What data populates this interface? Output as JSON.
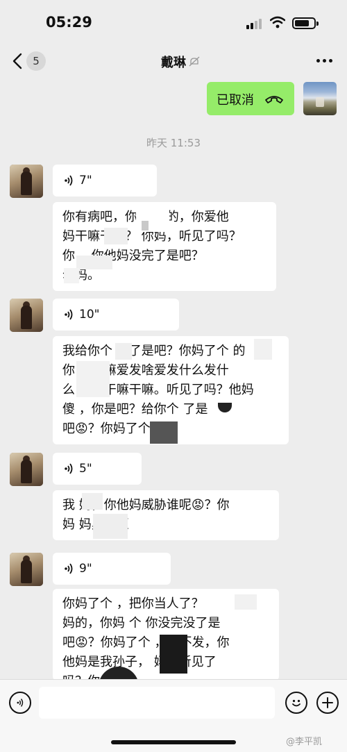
{
  "status_bar": {
    "time": "05:29",
    "battery_level": 0.75
  },
  "nav": {
    "unread_count": "5",
    "title": "戴琳"
  },
  "sent_call": {
    "label": "已取消"
  },
  "timestamp": "昨天 11:53",
  "messages": [
    {
      "voice_duration": "7\"",
      "lines": [
        "你有病吧，你    个逼的，你爱他",
        "妈干嘛干嘛？    你妈，听见了吗？",
        "你          ，你他妈没完了是吧？",
        "  尔妈。"
      ]
    },
    {
      "voice_duration": "10\"",
      "lines": [
        "我给你个    脸了是吧？你妈了个    的",
        "你      爱干嘛爱发啥爱发什么发什",
        "么，   爱干嘛干嘛。听见了吗？他妈",
        "傻    ，你是吧？给你个    了是",
        "吧😡？你妈了个    的。"
      ]
    },
    {
      "voice_duration": "5\"",
      "lines": [
        "我    妈，你他妈威胁谁呢😡？你",
        "妈        妈臭傻逼"
      ]
    },
    {
      "voice_duration": "9\"",
      "lines": [
        "你妈了个    ，把你当人了？    ",
        "妈的，你妈    个    你没完没了是",
        "吧😡？你妈了个    ，你不发，你",
        "他妈是我孙子，    妈，听见了",
        "吗？你"
      ]
    }
  ],
  "input_bar": {
    "placeholder": ""
  },
  "watermark": "@李平凯"
}
